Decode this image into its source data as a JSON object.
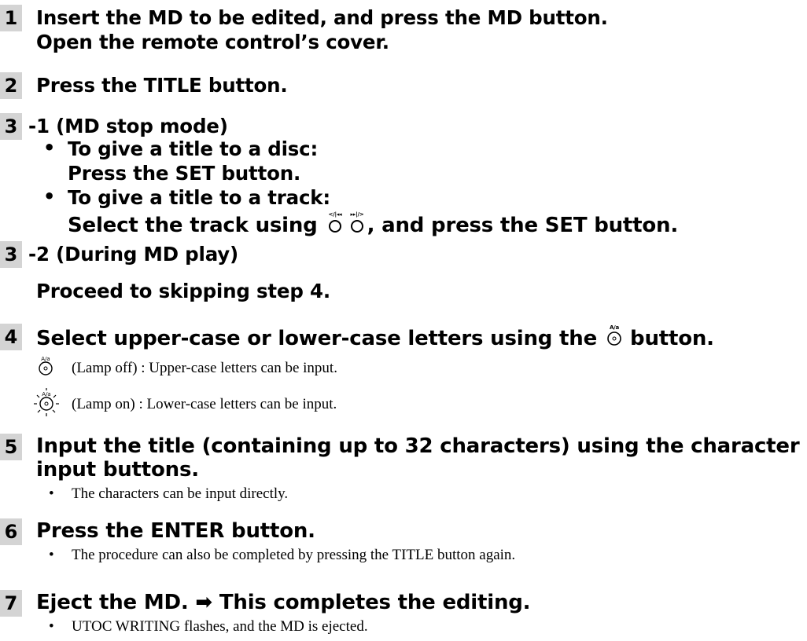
{
  "steps": {
    "s1": {
      "num": "1",
      "line1": "Insert the MD to be edited, and press the MD button.",
      "line2": "Open the remote control’s cover."
    },
    "s2": {
      "num": "2",
      "line1": "Press the TITLE button."
    },
    "s3a": {
      "num": "3",
      "heading": "-1 (MD stop mode)",
      "b1_line1": "To give a title to a disc:",
      "b1_line2": "Press the SET button.",
      "b2_line1": "To give a title to a track:",
      "b2_line2_pre": "Select the track using",
      "b2_line2_post": ", and press the SET button.",
      "bullet": "•"
    },
    "s3b": {
      "num": "3",
      "heading": "-2 (During MD play)",
      "line2": "Proceed to skipping step 4."
    },
    "s4": {
      "num": "4",
      "line1_pre": "Select upper-case or lower-case letters using the",
      "line1_post": "button.",
      "lamp_off": "(Lamp off) :  Upper-case letters can be input.",
      "lamp_on": "(Lamp on) :  Lower-case letters can be input."
    },
    "s5": {
      "num": "5",
      "line1": "Input the title (containing up to 32 characters) using the character",
      "line2": "input buttons.",
      "note": "The characters can be input directly."
    },
    "s6": {
      "num": "6",
      "line1": "Press the ENTER button.",
      "note": "The procedure can also be completed by pressing the TITLE button again."
    },
    "s7": {
      "num": "7",
      "line1": "Eject the MD. ➡ This completes the editing.",
      "note": "UTOC WRITING flashes, and the MD is ejected."
    }
  },
  "icons": {
    "aa_label": "A/a",
    "prev_label": "</⏮",
    "next_label": "⏭/>"
  },
  "colors": {
    "number_bg": "#d4d4d4",
    "text": "#000000"
  }
}
